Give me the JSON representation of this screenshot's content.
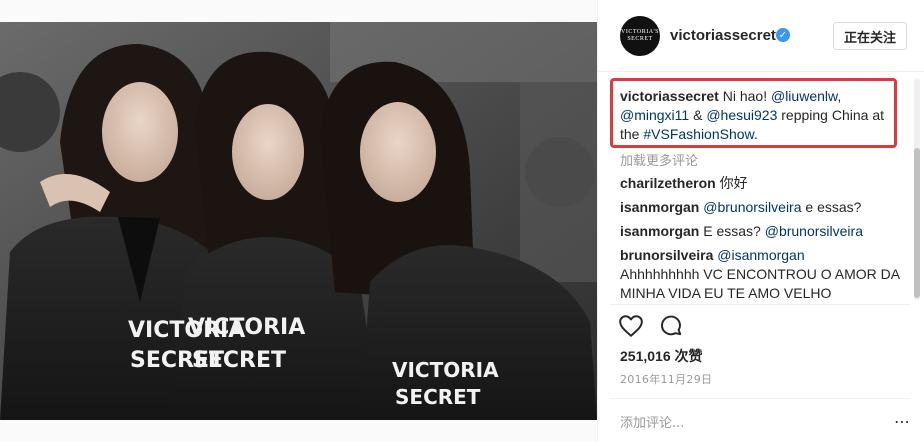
{
  "post": {
    "username": "victoriassecret",
    "avatar_text": [
      "VICTORIA'S",
      "SECRET"
    ],
    "follow_label": "正在关注",
    "caption": {
      "author": "victoriassecret",
      "text1": " Ni hao! ",
      "mention1": "@liuwenlw",
      "text2": ", ",
      "mention2": "@mingxi11",
      "text3": " & ",
      "mention3": "@hesui923",
      "text4": " repping China at the ",
      "hashtag": "#VSFashionShow",
      "text5": "."
    },
    "load_more": "加载更多评论",
    "comments": [
      {
        "user": "charilzetheron",
        "text": "你好"
      },
      {
        "user": "isanmorgan",
        "mention": "@brunorsilveira",
        "text": " e essas?"
      },
      {
        "user": "isanmorgan",
        "prefix": " E essas? ",
        "mention": "@brunorsilveira"
      },
      {
        "user": "brunorsilveira",
        "mention": "@isanmorgan",
        "text": "Ahhhhhhhhh VC ENCONTROU O AMOR DA MINHA VIDA EU TE AMO VELHO"
      }
    ],
    "likes": "251,016 次赞",
    "date": "2016年11月29日",
    "add_comment_placeholder": "添加评论...",
    "icons": {
      "heart": "heart-icon",
      "comment": "comment-icon",
      "verified": "verified-badge-icon",
      "more": "more-options-icon"
    },
    "colors": {
      "accent": "#3897f0",
      "highlight_box": "#e0393c",
      "mention": "#003569",
      "muted": "#999999"
    },
    "photo_text": [
      "VICTORIA",
      "SECRET",
      "VICTORIA",
      "SECRET",
      "VICTORIA",
      "SECRET"
    ]
  }
}
